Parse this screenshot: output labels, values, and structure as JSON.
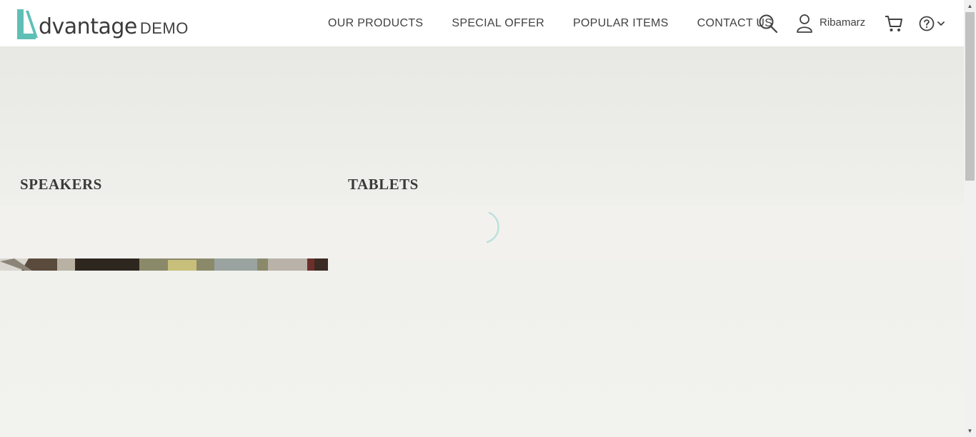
{
  "header": {
    "logo": {
      "word": "dvantage",
      "suffix": "DEMO",
      "accent_color": "#5fbfb7"
    },
    "nav": [
      {
        "label": "OUR PRODUCTS"
      },
      {
        "label": "SPECIAL OFFER"
      },
      {
        "label": "POPULAR ITEMS"
      },
      {
        "label": "CONTACT US"
      }
    ],
    "icons": {
      "search": "search-icon",
      "user": "user-icon",
      "cart": "cart-icon",
      "help": "help-icon",
      "dropdown": "chevron-down-icon"
    },
    "user_name": "Ribamarz"
  },
  "categories": [
    {
      "label": "SPEAKERS"
    },
    {
      "label": "TABLETS"
    }
  ],
  "colors": {
    "text": "#414141",
    "background": "#efefeb",
    "loader": "#5fbfb7"
  }
}
